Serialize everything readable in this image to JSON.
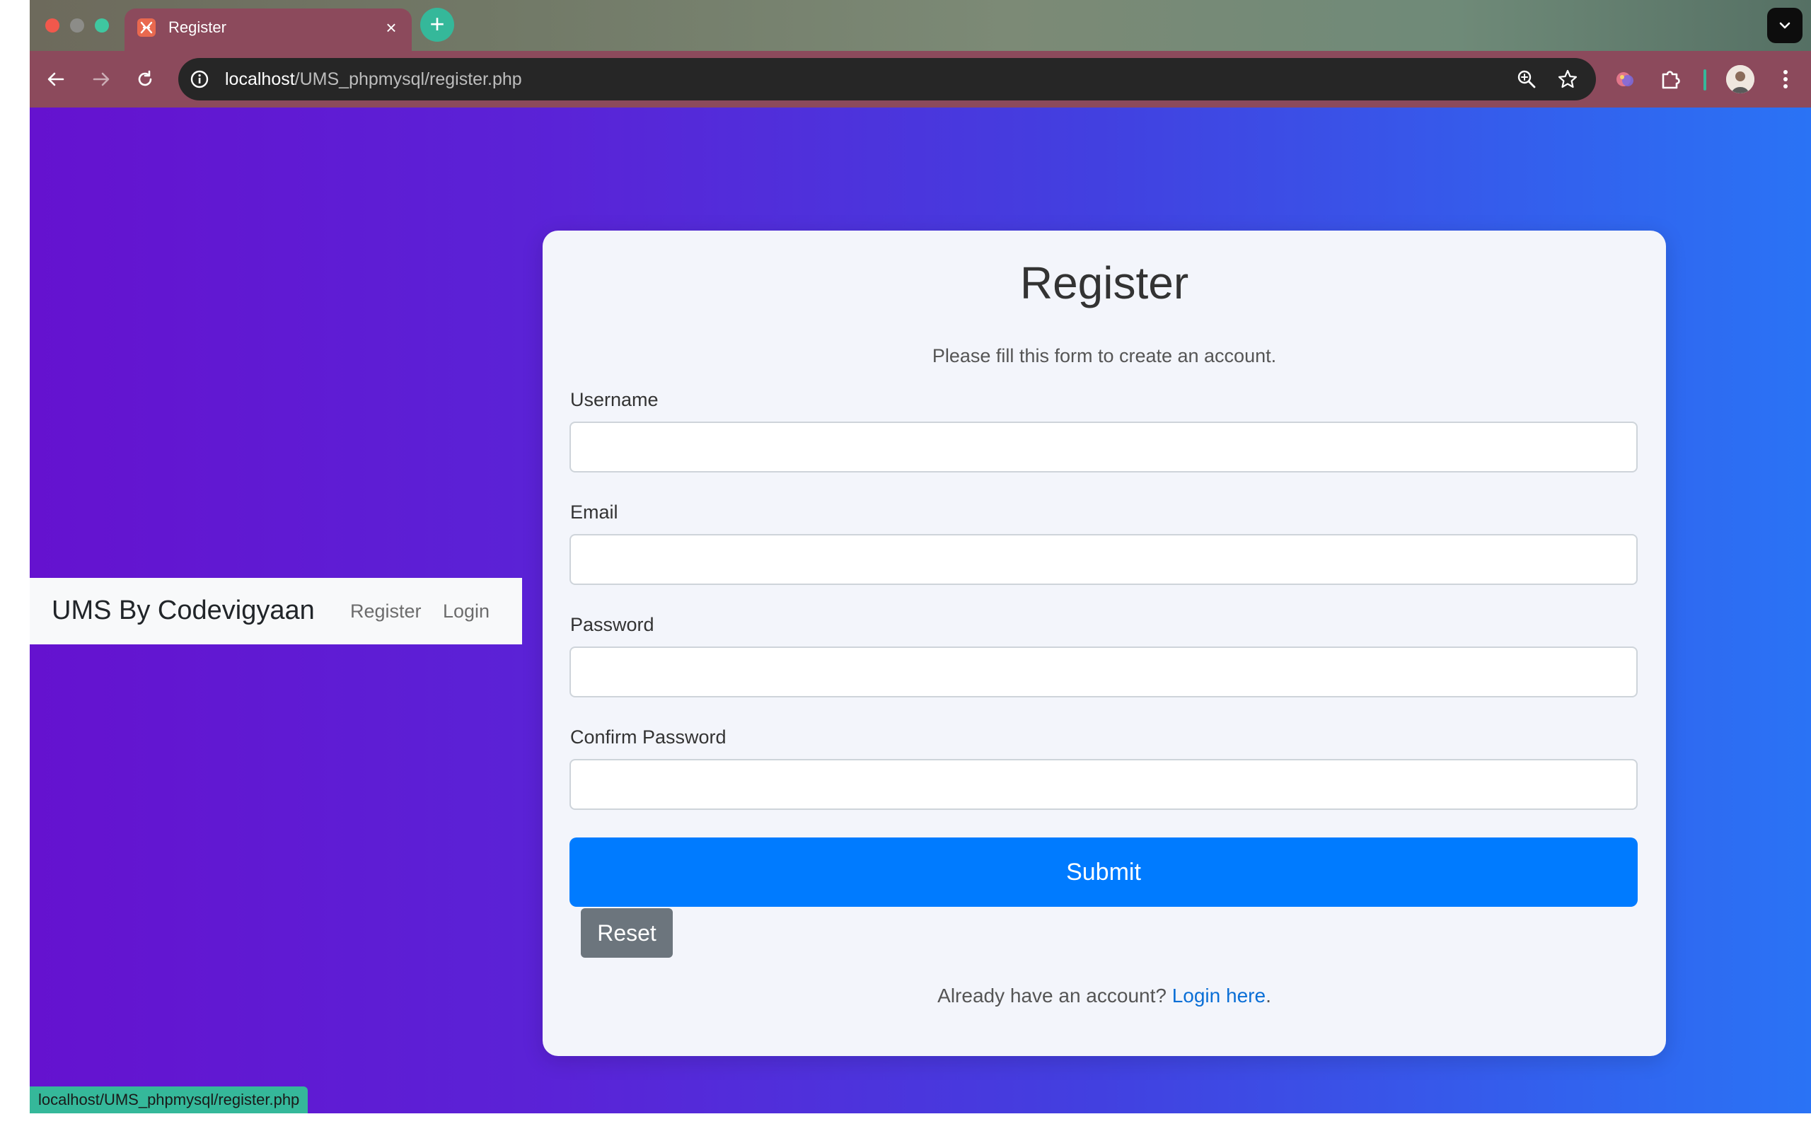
{
  "browser": {
    "tab_title": "Register",
    "tab_close": "×",
    "new_tab": "+",
    "url_host": "localhost",
    "url_path": "/UMS_phpmysql/register.php",
    "status_url": "localhost/UMS_phpmysql/register.php"
  },
  "navbar": {
    "brand": "UMS By Codevigyaan",
    "links": [
      "Register",
      "Login"
    ]
  },
  "form": {
    "title": "Register",
    "subtitle": "Please fill this form to create an account.",
    "fields": [
      {
        "label": "Username",
        "value": ""
      },
      {
        "label": "Email",
        "value": ""
      },
      {
        "label": "Password",
        "value": ""
      },
      {
        "label": "Confirm Password",
        "value": ""
      }
    ],
    "submit_label": "Submit",
    "reset_label": "Reset",
    "footer_prefix": "Already have an account? ",
    "footer_link": "Login here",
    "footer_suffix": "."
  },
  "colors": {
    "primary": "#007bff",
    "secondary": "#6c757d",
    "accent_teal": "#35b89a",
    "tab_bar": "#8c4a5c"
  },
  "icons": {
    "tab_favicon": "xampp-icon",
    "back": "arrow-left-icon",
    "forward": "arrow-right-icon",
    "reload": "reload-icon",
    "site_info": "info-icon",
    "zoom": "zoom-icon",
    "bookmark": "star-icon",
    "extensions": "puzzle-icon",
    "menu": "kebab-menu-icon"
  }
}
